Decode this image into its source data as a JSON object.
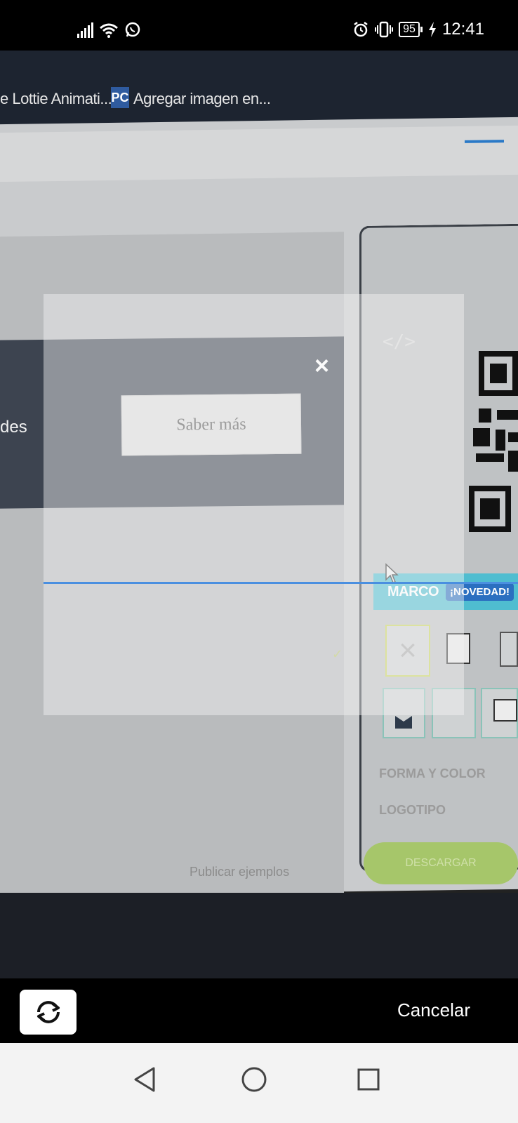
{
  "status_bar": {
    "battery_level": "95",
    "time": "12:41",
    "icons": [
      "signal-icon",
      "wifi-icon",
      "whatsapp-icon",
      "alarm-icon",
      "vibrate-icon",
      "battery-icon",
      "charging-icon"
    ]
  },
  "monitor": {
    "tabs": [
      {
        "label": "e Lottie Animati..."
      },
      {
        "label": "Agregar imagen en...",
        "badge": "PC"
      }
    ],
    "banner": {
      "partial_text": "des",
      "button_label": "Saber más",
      "close_label": "×"
    },
    "panel": {
      "marco_label": "MARCO",
      "novedad_label": "¡NOVEDAD!",
      "forma_label": "FORMA Y COLOR",
      "logotipo_label": "LOGOTIPO",
      "download_label": "DESCARGAR"
    },
    "faded_text": "Publicar ejemplos"
  },
  "controls": {
    "cancel_label": "Cancelar"
  },
  "colors": {
    "accent_blue": "#4a8fe0",
    "marco_bar": "#4fbdd0",
    "novedad_badge": "#2b6fc0",
    "download_green": "#a6c66a"
  }
}
